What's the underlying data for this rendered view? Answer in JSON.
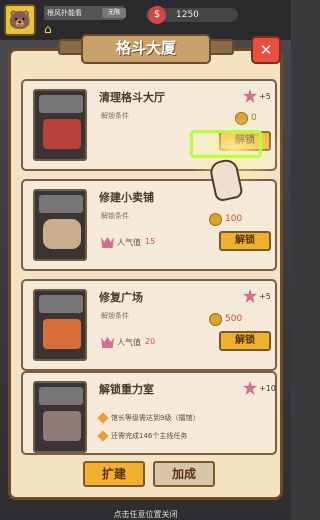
{
  "top": {
    "player_name": "根风扑能看",
    "tag": "无限",
    "cash": "1250"
  },
  "title": "格斗大厦",
  "cards": [
    {
      "title": "清理格斗大厅",
      "requirement_label": "解锁条件",
      "reward": "+5",
      "coin": "0",
      "button": "解锁"
    },
    {
      "title": "修建小卖铺",
      "requirement_label": "解锁条件",
      "coin": "100",
      "popularity_label": "人气值",
      "popularity_value": "15",
      "button": "解锁"
    },
    {
      "title": "修复广场",
      "requirement_label": "解锁条件",
      "reward": "+5",
      "coin": "500",
      "popularity_label": "人气值",
      "popularity_value": "20",
      "button": "解锁"
    },
    {
      "title": "解锁重力室",
      "reward": "+10",
      "req1": "馆长等级需达到9级（擂馆）",
      "req2": "还需完成146个主线任务"
    }
  ],
  "buttons": {
    "expand": "扩建",
    "finish": "加成"
  },
  "hint": "点击任意位置关闭"
}
